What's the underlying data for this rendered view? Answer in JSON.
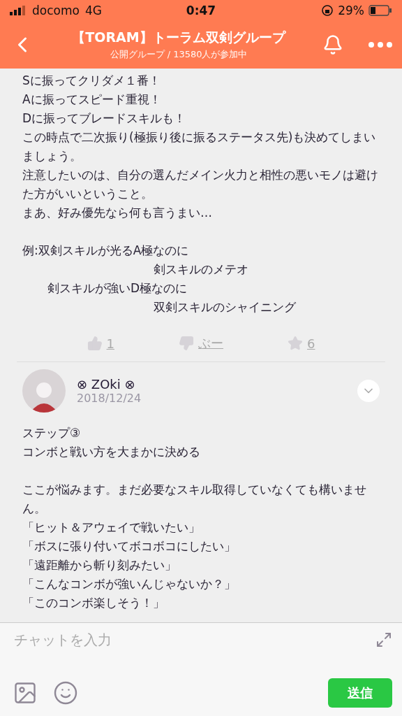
{
  "status_bar": {
    "carrier": "docomo",
    "network": "4G",
    "time": "0:47",
    "battery": "29%"
  },
  "header": {
    "title": "【TORAM】トーラム双剣グループ",
    "subtitle": "公開グループ / 13580人が参加中"
  },
  "posts": [
    {
      "paragraphs": [
        [
          "Sに振ってクリダメ１番！",
          "Aに振ってスピード重視！",
          "Dに振ってブレードスキルも！",
          "この時点で二次振り(極振り後に振るステータス先)も決めてしまいましょう。",
          "注意したいのは、自分の選んだメイン火力と相性の悪いモノは避けた方がいいということ。",
          "まあ、好み優先なら何も言うまい…"
        ]
      ],
      "example": [
        {
          "text": "例:双剣スキルが光るA極なのに",
          "kind": "lead"
        },
        {
          "text": "剣スキルのメテオ",
          "kind": "far"
        },
        {
          "text": "剣スキルが強いD極なのに",
          "kind": "near"
        },
        {
          "text": "双剣スキルのシャイニング",
          "kind": "far"
        }
      ],
      "reactions": {
        "likes": "1",
        "dislike": "ぶー",
        "stars": "6"
      }
    },
    {
      "author": "⊗ ZOki ⊗",
      "date": "2018/12/24",
      "paragraphs": [
        [
          "ステップ③",
          "コンボと戦い方を大まかに決める"
        ],
        [
          "ここが悩みます。まだ必要なスキル取得していなくても構いません。",
          "「ヒット＆アウェイで戦いたい」",
          "「ボスに張り付いてボコボコにしたい」",
          "「遠距離から斬り刻みたい」",
          "「こんなコンボが強いんじゃないか？」",
          "「このコンボ楽しそう！」"
        ]
      ]
    }
  ],
  "composer": {
    "placeholder": "チャットを入力",
    "send": "送信"
  }
}
